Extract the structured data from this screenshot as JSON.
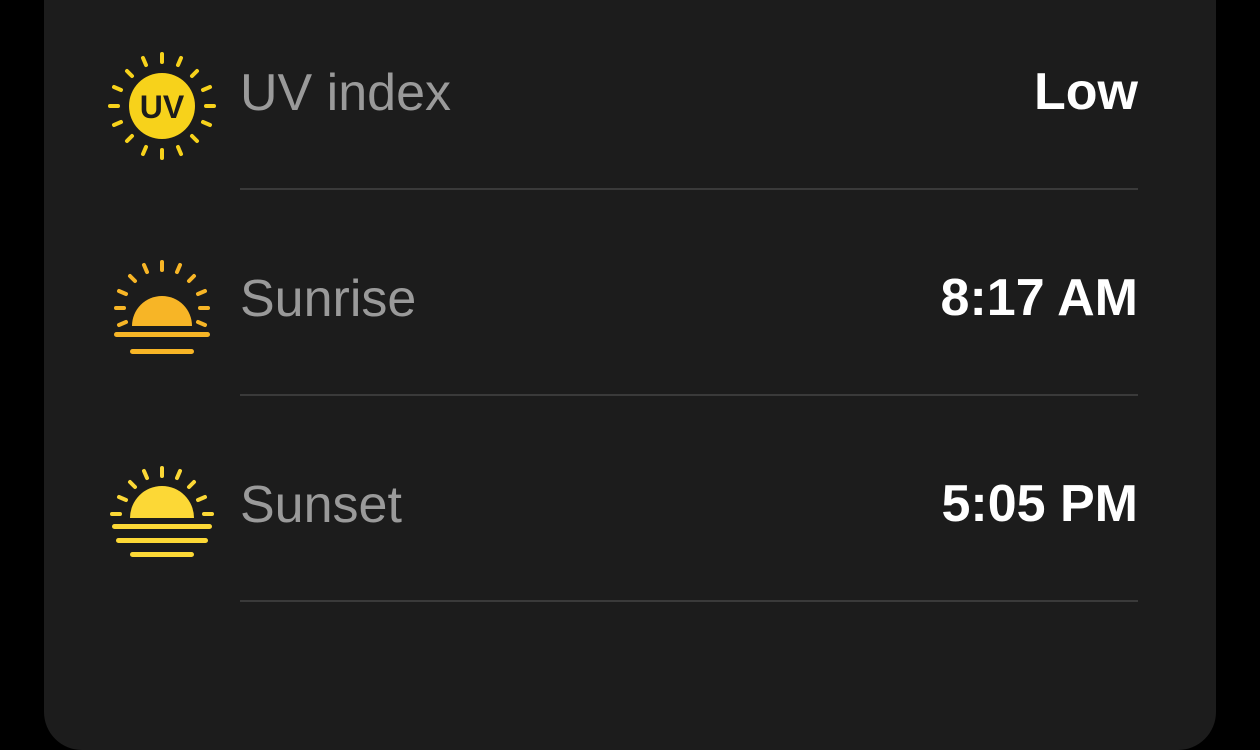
{
  "rows": [
    {
      "label": "UV index",
      "value": "Low",
      "icon": "uv-index-icon"
    },
    {
      "label": "Sunrise",
      "value": "8:17 AM",
      "icon": "sunrise-icon"
    },
    {
      "label": "Sunset",
      "value": "5:05 PM",
      "icon": "sunset-icon"
    }
  ],
  "uv_badge_text": "UV",
  "colors": {
    "card_background": "#1c1c1c",
    "page_background": "#000000",
    "label": "#9a9a9a",
    "value": "#ffffff",
    "divider": "#3a3a3a",
    "uv_yellow": "#f7d21b",
    "sunrise_orange": "#f7b526",
    "sunset_yellow": "#fcd836"
  }
}
